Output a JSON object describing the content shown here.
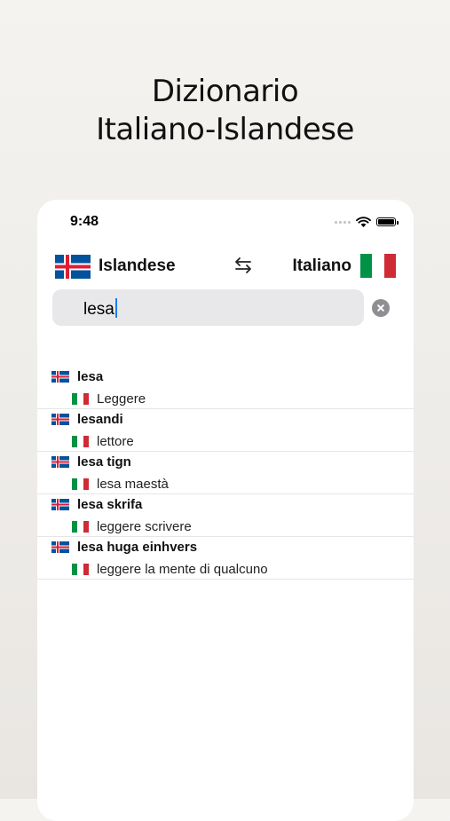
{
  "headline": {
    "line1": "Dizionario",
    "line2": "Italiano-Islandese"
  },
  "status_bar": {
    "time": "9:48"
  },
  "language_bar": {
    "from": "Islandese",
    "to": "Italiano",
    "swap_icon": "swap-arrows-icon"
  },
  "search": {
    "value": "lesa"
  },
  "colors": {
    "iceland_blue": "#02529C",
    "iceland_red": "#DC1E35",
    "italy_green": "#009246",
    "italy_red": "#CE2B37",
    "caret": "#1a7cf6"
  },
  "results": [
    {
      "word": "lesa",
      "translation": "Leggere"
    },
    {
      "word": "lesandi",
      "translation": "lettore"
    },
    {
      "word": "lesa tign",
      "translation": "lesa maestà"
    },
    {
      "word": "lesa skrifa",
      "translation": "leggere scrivere"
    },
    {
      "word": "lesa huga einhvers",
      "translation": "leggere la mente di qualcuno"
    }
  ]
}
